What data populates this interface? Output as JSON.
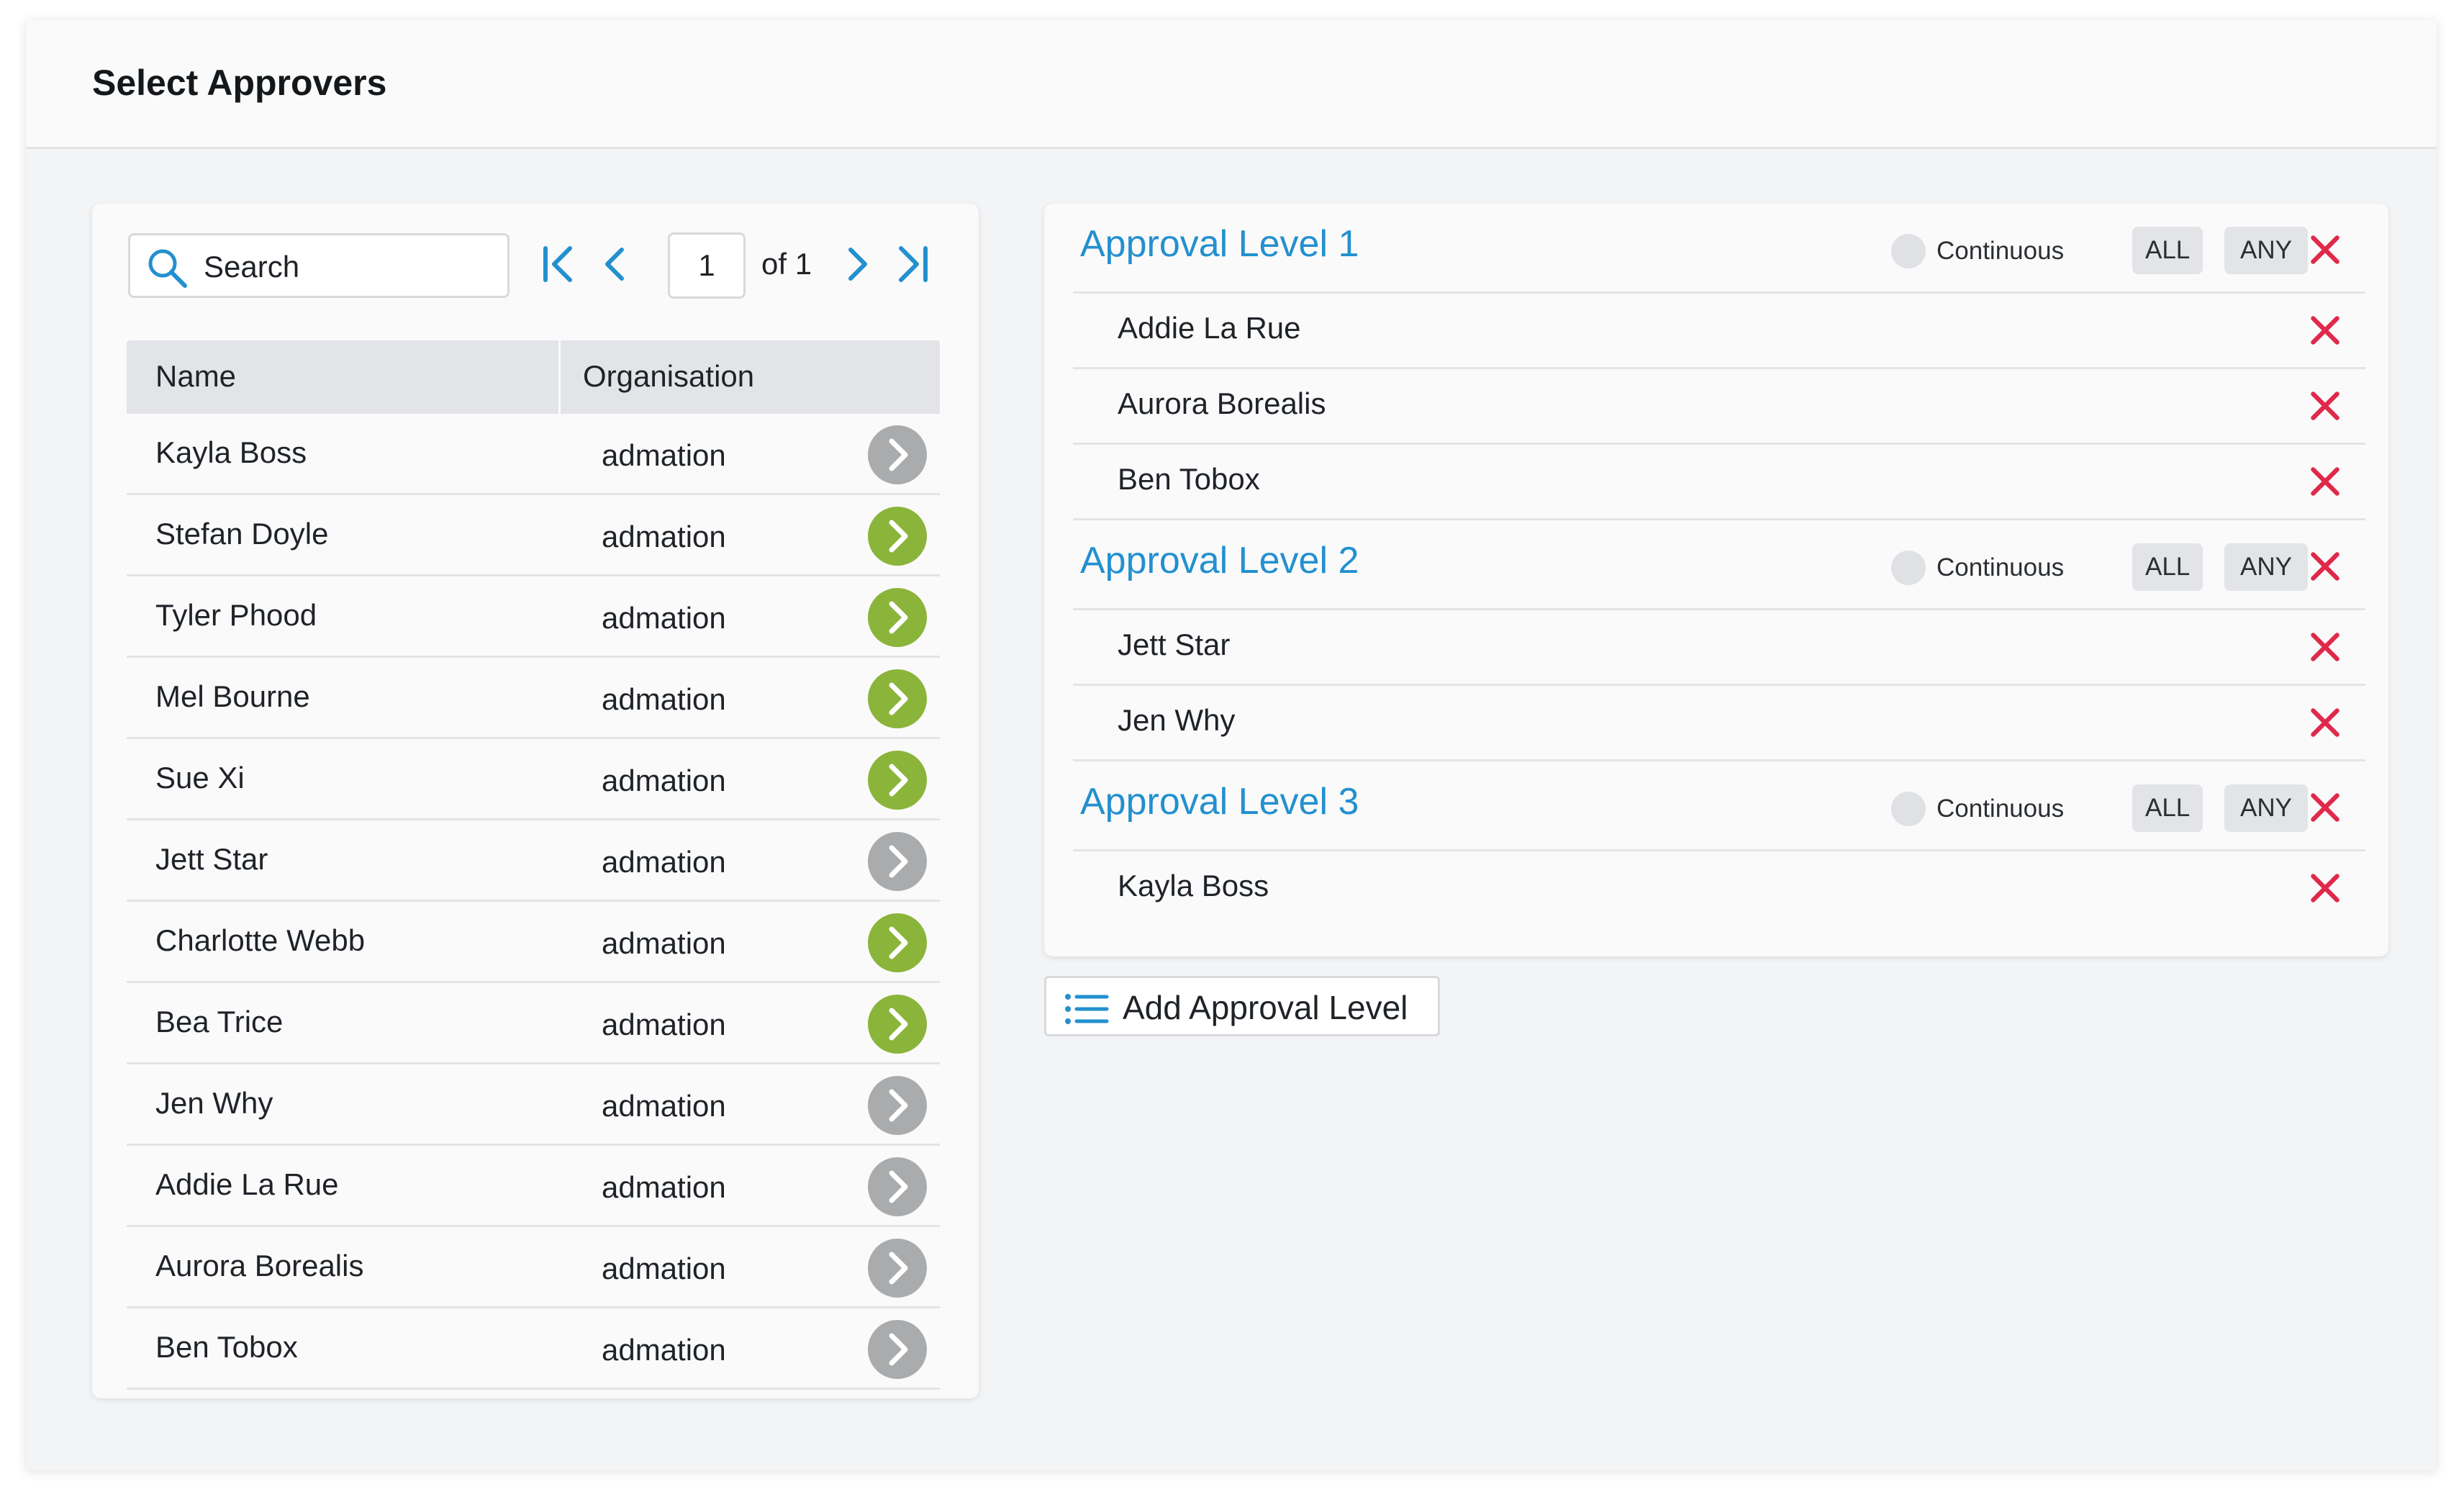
{
  "header": {
    "title": "Select Approvers"
  },
  "search": {
    "placeholder": "Search"
  },
  "pager": {
    "page": "1",
    "of_label": "of 1"
  },
  "table": {
    "columns": [
      "Name",
      "Organisation"
    ],
    "rows": [
      {
        "name": "Kayla Boss",
        "org": "admation",
        "state": "added"
      },
      {
        "name": "Stefan Doyle",
        "org": "admation",
        "state": "available"
      },
      {
        "name": "Tyler Phood",
        "org": "admation",
        "state": "available"
      },
      {
        "name": "Mel Bourne",
        "org": "admation",
        "state": "available"
      },
      {
        "name": "Sue Xi",
        "org": "admation",
        "state": "available"
      },
      {
        "name": "Jett Star",
        "org": "admation",
        "state": "added"
      },
      {
        "name": "Charlotte Webb",
        "org": "admation",
        "state": "available"
      },
      {
        "name": "Bea Trice",
        "org": "admation",
        "state": "available"
      },
      {
        "name": "Jen Why",
        "org": "admation",
        "state": "added"
      },
      {
        "name": "Addie La Rue",
        "org": "admation",
        "state": "added"
      },
      {
        "name": "Aurora Borealis",
        "org": "admation",
        "state": "added"
      },
      {
        "name": "Ben Tobox",
        "org": "admation",
        "state": "added"
      }
    ]
  },
  "levels": [
    {
      "title": "Approval Level 1",
      "continuous_label": "Continuous",
      "all_label": "ALL",
      "any_label": "ANY",
      "members": [
        "Addie La Rue",
        "Aurora Borealis",
        "Ben Tobox"
      ]
    },
    {
      "title": "Approval Level 2",
      "continuous_label": "Continuous",
      "all_label": "ALL",
      "any_label": "ANY",
      "members": [
        "Jett Star",
        "Jen Why"
      ]
    },
    {
      "title": "Approval Level 3",
      "continuous_label": "Continuous",
      "all_label": "ALL",
      "any_label": "ANY",
      "members": [
        "Kayla Boss"
      ]
    }
  ],
  "add_level": {
    "label": "Add Approval Level",
    "icon": "list-icon"
  },
  "colors": {
    "accent_blue": "#2390cf",
    "add_green": "#8bb43a",
    "added_gray": "#a9abad",
    "remove_red": "#e0294a"
  },
  "icons": {
    "search": "search-icon",
    "first": "first-page-icon",
    "prev": "chevron-left-icon",
    "next": "chevron-right-icon",
    "last": "last-page-icon",
    "row_action": "arrow-right-circle-icon",
    "remove": "close-icon"
  }
}
